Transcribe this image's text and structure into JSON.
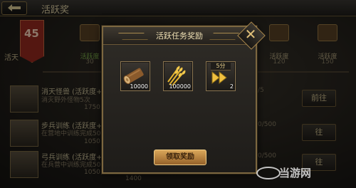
{
  "topbar": {
    "back_icon": "back-arrow-icon",
    "title": "活跃奖"
  },
  "banner": {
    "number": "45",
    "left_label": "活天"
  },
  "chests": [
    {
      "label": "活跃度",
      "value": "30",
      "label_color": "#7db04a"
    },
    {
      "label": "活跃度",
      "value": "120",
      "label_color": "#b7a881"
    },
    {
      "label": "活跃度",
      "value": "150",
      "label_color": "#b7a881"
    }
  ],
  "tasks": [
    {
      "title": "消天怪兽 (活跃度+5)",
      "desc": "消灭野外怪物5次",
      "reward": "1750",
      "progress": "/5",
      "button": "前往"
    },
    {
      "title": "步兵训练 (活跃度+10",
      "desc": "在营地中训练完成50",
      "reward": "1050",
      "progress": "0/500",
      "button": "往"
    },
    {
      "title": "弓兵训练 (活跃度+10",
      "desc": "在兵营中训练完成50",
      "reward": "1050",
      "progress": "0/500",
      "button": "往"
    }
  ],
  "bottom_value": "1400",
  "modal": {
    "title": "活跃任务奖励",
    "close_icon": "close-icon",
    "rewards": [
      {
        "icon": "wood-log-icon",
        "quantity": "10000",
        "badge": ""
      },
      {
        "icon": "wheat-icon",
        "quantity": "100000",
        "badge": ""
      },
      {
        "icon": "speedup-arrows-icon",
        "quantity": "2",
        "badge": "5分"
      }
    ],
    "claim_label": "领取奖励"
  },
  "watermark": {
    "text": "当游网"
  }
}
